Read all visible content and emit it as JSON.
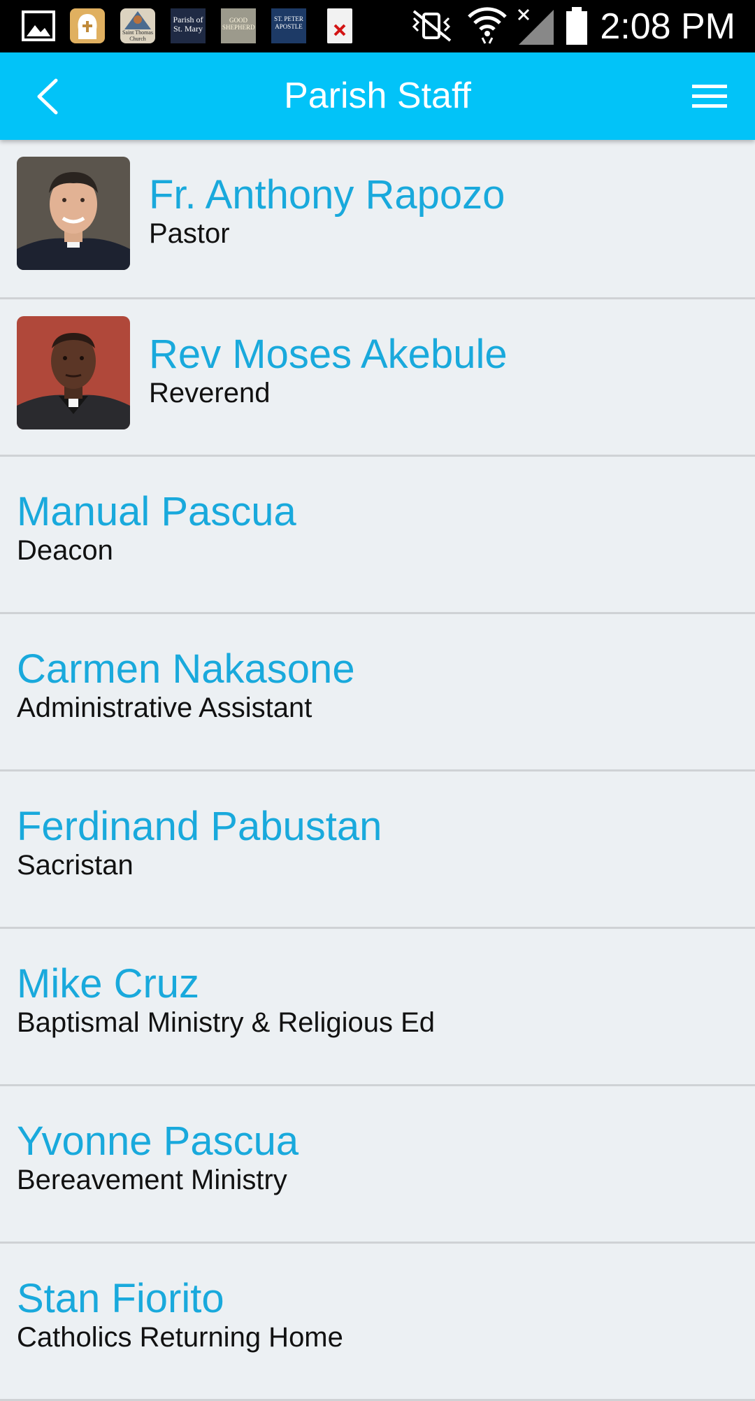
{
  "status_bar": {
    "time": "2:08 PM",
    "notification_icons": [
      "gallery-icon",
      "parish-app-icon",
      "saint-thomas-icon",
      "st-mary-icon",
      "good-shepherd-icon",
      "st-peter-apostle-icon",
      "close-file-icon"
    ],
    "notif_labels": {
      "saint_thomas": "Saint Thomas Church",
      "st_mary": "Parish of St. Mary",
      "good_shepherd": "GOOD SHEPHERD",
      "st_peter": "ST. PETER APOSTLE"
    }
  },
  "header": {
    "title": "Parish Staff",
    "back_icon": "chevron-left-icon",
    "menu_icon": "hamburger-menu-icon"
  },
  "colors": {
    "header_bg": "#02c3f8",
    "name_text": "#19a9dc",
    "page_bg": "#ecf0f3"
  },
  "staff": [
    {
      "name": "Fr. Anthony Rapozo",
      "role": "Pastor",
      "photo": true
    },
    {
      "name": "Rev Moses Akebule",
      "role": "Reverend",
      "photo": true
    },
    {
      "name": "Manual Pascua",
      "role": "Deacon",
      "photo": false
    },
    {
      "name": "Carmen Nakasone",
      "role": "Administrative Assistant",
      "photo": false
    },
    {
      "name": "Ferdinand Pabustan",
      "role": "Sacristan",
      "photo": false
    },
    {
      "name": "Mike Cruz",
      "role": "Baptismal Ministry & Religious Ed",
      "photo": false
    },
    {
      "name": "Yvonne Pascua",
      "role": "Bereavement Ministry",
      "photo": false
    },
    {
      "name": "Stan Fiorito",
      "role": "Catholics Returning Home",
      "photo": false
    }
  ]
}
